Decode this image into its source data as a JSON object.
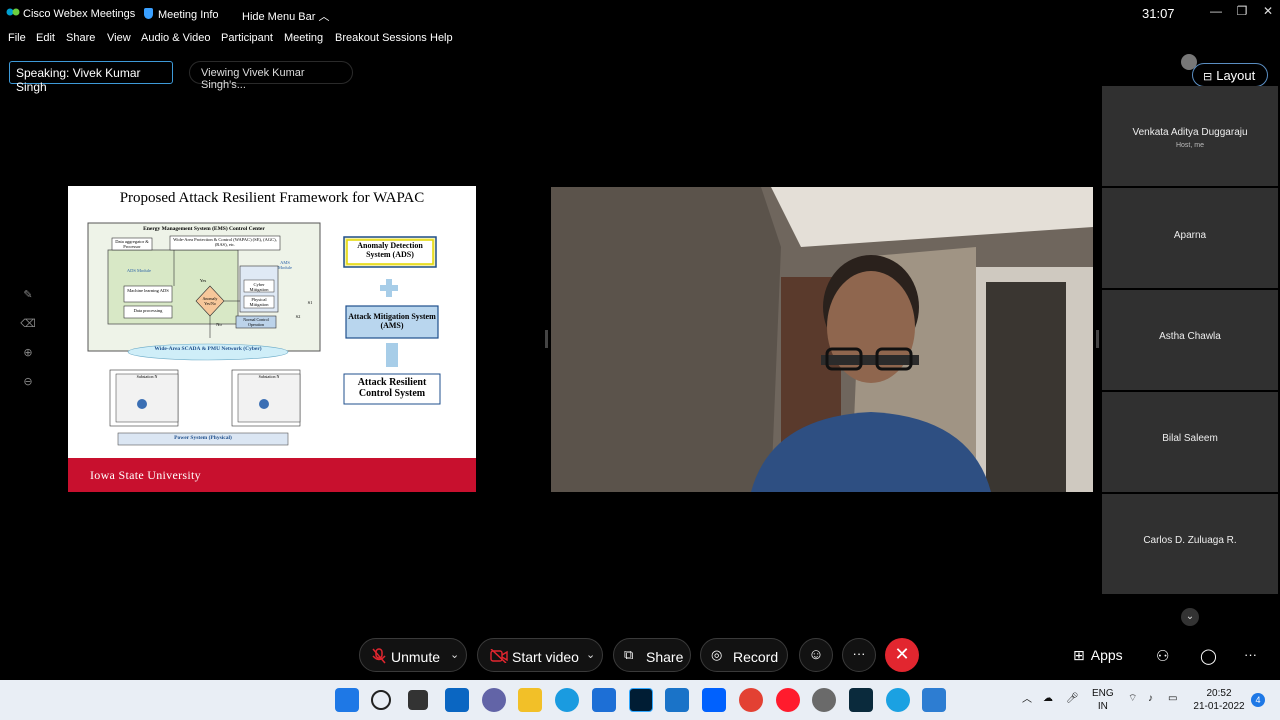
{
  "titlebar": {
    "app_name": "Cisco Webex Meetings",
    "meeting_info": "Meeting Info",
    "hide_menu_bar": "Hide Menu Bar",
    "timer": "31:07"
  },
  "menu": [
    "File",
    "Edit",
    "Share",
    "View",
    "Audio & Video",
    "Participant",
    "Meeting",
    "Breakout Sessions",
    "Help"
  ],
  "status": {
    "speaking_label": "Speaking:",
    "speaking_name": "Vivek Kumar Singh",
    "viewing": "Viewing Vivek Kumar Singh's..."
  },
  "layout_button": "Layout",
  "slide": {
    "title": "Proposed Attack Resilient Framework for WAPAC",
    "ems": "Energy Management System (EMS) Control Center",
    "data_agg": "Data aggregator & Processor",
    "wapac": "Wide-Area Protection & Control (WAPAC) (SE), (AGC), (RAS), etc.",
    "ads_module": "ADS Module",
    "ams_module": "AMS Module",
    "ml": "Machine learning ADS",
    "dp": "Data processing",
    "anomaly": "Anomaly Yes/No",
    "yes": "Yes",
    "no": "No",
    "cyber_mit": "Cyber Mitigation",
    "phys_mit": "Physical Mitigation",
    "normal": "Normal Control Operation",
    "s1": "S1",
    "s2": "S2",
    "scada": "Wide-Area SCADA & PMU Network (Cyber)",
    "substation": "Substation N",
    "power": "Power System (Physical)",
    "ads_box": "Anomaly Detection System (ADS)",
    "ams_box": "Attack Mitigation System (AMS)",
    "arcs_box": "Attack Resilient Control System",
    "university": "Iowa State University"
  },
  "participants": [
    {
      "name": "Venkata Aditya Duggaraju",
      "role": "Host, me"
    },
    {
      "name": "Aparna"
    },
    {
      "name": "Astha Chawla"
    },
    {
      "name": "Bilal Saleem"
    },
    {
      "name": "Carlos D. Zuluaga R."
    }
  ],
  "controls": {
    "unmute": "Unmute",
    "start_video": "Start video",
    "share": "Share",
    "record": "Record",
    "apps": "Apps"
  },
  "taskbar": {
    "lang1": "ENG",
    "lang2": "IN",
    "time": "20:52",
    "date": "21-01-2022",
    "notifications": "4"
  },
  "colors": {
    "accent": "#3e9ad8",
    "end_meeting": "#e2262f",
    "mute_red": "#e2262f",
    "isu_red": "#c8102e"
  }
}
